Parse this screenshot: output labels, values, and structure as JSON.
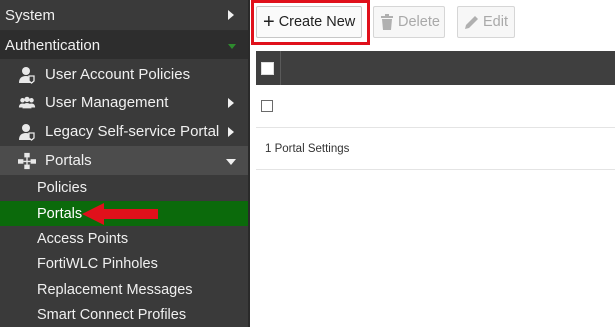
{
  "sidebar": {
    "system": {
      "label": "System"
    },
    "authentication": {
      "label": "Authentication"
    },
    "items": [
      {
        "label": "User Account Policies",
        "icon": "user-policy-icon"
      },
      {
        "label": "User Management",
        "icon": "users-icon"
      },
      {
        "label": "Legacy Self-service Portal",
        "icon": "user-policy-icon"
      },
      {
        "label": "Portals",
        "icon": "network-icon"
      }
    ],
    "portals_children": [
      {
        "label": "Policies"
      },
      {
        "label": "Portals"
      },
      {
        "label": "Access Points"
      },
      {
        "label": "FortiWLC Pinholes"
      },
      {
        "label": "Replacement Messages"
      },
      {
        "label": "Smart Connect Profiles"
      }
    ]
  },
  "toolbar": {
    "create_label": "Create New",
    "delete_label": "Delete",
    "edit_label": "Edit"
  },
  "table": {
    "footer_text": "1 Portal Settings"
  },
  "colors": {
    "sidebar_bg": "#3a3a3a",
    "selected_bg": "#0b6a0b",
    "highlight_red": "#e0101b"
  }
}
